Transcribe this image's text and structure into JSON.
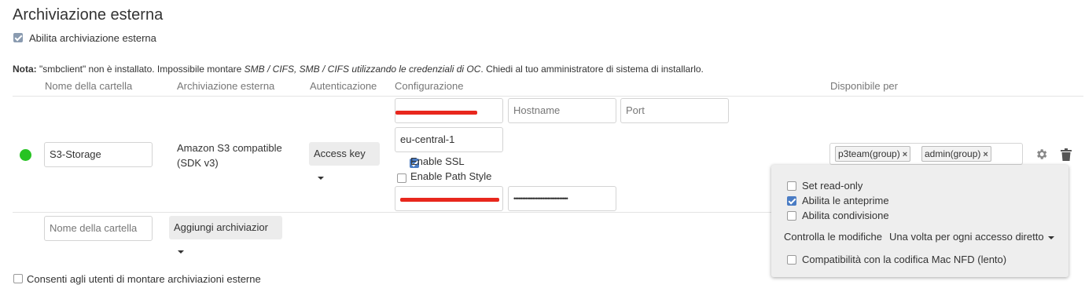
{
  "page": {
    "title": "Archiviazione esterna"
  },
  "enable_external": {
    "label": "Abilita archiviazione esterna",
    "checked": true
  },
  "note": {
    "prefix": "Nota:",
    "text1": " \"smbclient\" non è installato. Impossibile montare ",
    "italic": "SMB / CIFS, SMB / CIFS utilizzando le credenziali di OC",
    "text2": ". Chiedi al tuo amministratore di sistema di installarlo."
  },
  "table": {
    "headers": {
      "folder_name": "Nome della cartella",
      "storage": "Archiviazione esterna",
      "auth": "Autenticazione",
      "config": "Configurazione",
      "available_for": "Disponibile per"
    }
  },
  "mount": {
    "status_color": "#27c323",
    "folder_name": "S3-Storage",
    "storage_type": "Amazon S3 compatible (SDK v3)",
    "storage_line1": "Amazon S3 compatible",
    "storage_line2": "(SDK v3)",
    "auth_label": "Access key",
    "config": {
      "hostname_placeholder": "Hostname",
      "port_placeholder": "Port",
      "region": "eu-central-1",
      "enable_ssl": {
        "label": "Enable SSL",
        "checked": true
      },
      "enable_path_style": {
        "label": "Enable Path Style",
        "checked": false
      },
      "secret_masked": "••••••••••••••••••••••••••••••••"
    },
    "applicable": [
      "p3team(group)",
      "admin(group)"
    ],
    "tag_remove_glyph": "×"
  },
  "new_row": {
    "folder_placeholder": "Nome della cartella",
    "add_storage_label": "Aggiungi archiviazior"
  },
  "options_popup": {
    "read_only": {
      "label": "Set read-only",
      "checked": false
    },
    "previews": {
      "label": "Abilita le anteprime",
      "checked": true
    },
    "sharing": {
      "label": "Abilita condivisione",
      "checked": false
    },
    "watch_label": "Controlla le modifiche",
    "watch_value": "Una volta per ogni accesso diretto",
    "nfd": {
      "label": "Compatibilità con la codifica Mac NFD (lento)",
      "checked": false
    }
  },
  "allow_users": {
    "label": "Consenti agli utenti di montare archiviazioni esterne",
    "checked": false
  },
  "colors": {
    "accent": "#4a7cc4",
    "redaction": "#e8271d",
    "status_ok": "#27c323"
  }
}
